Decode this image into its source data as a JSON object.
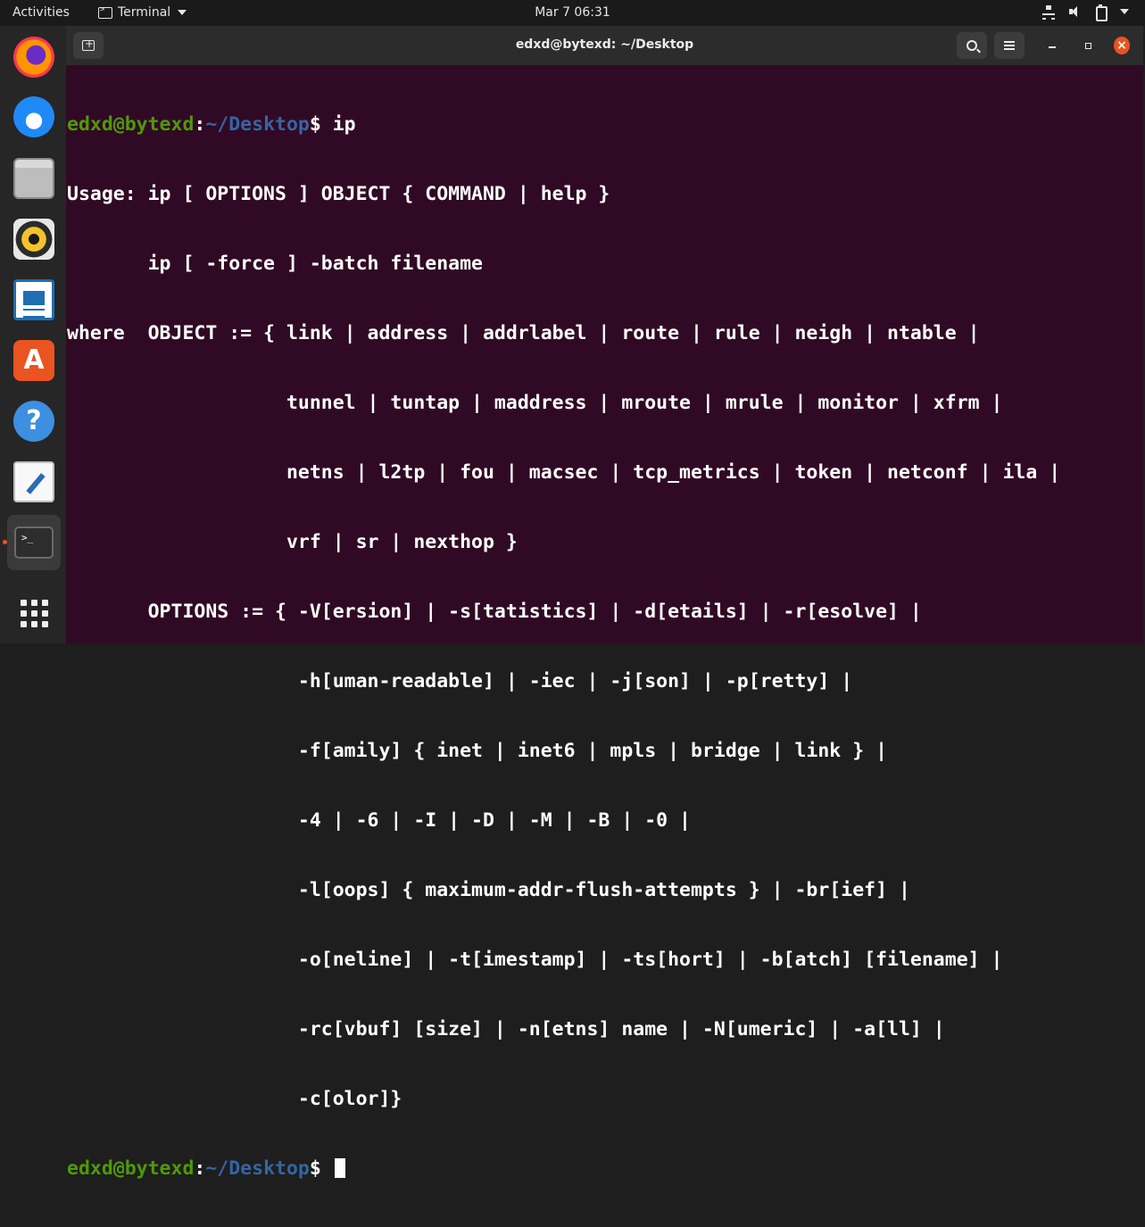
{
  "topbar": {
    "activities": "Activities",
    "app_name": "Terminal",
    "clock": "Mar 7  06:31",
    "icons": [
      "network-icon",
      "volume-icon",
      "battery-icon",
      "system-menu-caret"
    ]
  },
  "dock": {
    "apps": [
      {
        "name": "firefox",
        "icon": "firefox-icon"
      },
      {
        "name": "thunderbird",
        "icon": "thunderbird-icon"
      },
      {
        "name": "files",
        "icon": "files-icon"
      },
      {
        "name": "rhythmbox",
        "icon": "rhythmbox-icon"
      },
      {
        "name": "libreoffice-writer",
        "icon": "writer-icon"
      },
      {
        "name": "ubuntu-software",
        "icon": "software-icon"
      },
      {
        "name": "help",
        "icon": "help-icon"
      },
      {
        "name": "text-editor",
        "icon": "text-editor-icon"
      },
      {
        "name": "terminal",
        "icon": "terminal-icon",
        "active": true
      },
      {
        "name": "show-applications",
        "icon": "app-grid-icon"
      }
    ],
    "software_glyph": "A",
    "help_glyph": "?",
    "terminal_glyph": ">_"
  },
  "window": {
    "title": "edxd@bytexd: ~/Desktop",
    "close_glyph": "×"
  },
  "terminal": {
    "prompt_user": "edxd@bytexd",
    "prompt_sep": ":",
    "prompt_path": "~/Desktop",
    "prompt_end": "$ ",
    "command": "ip",
    "output": [
      "Usage: ip [ OPTIONS ] OBJECT { COMMAND | help }",
      "       ip [ -force ] -batch filename",
      "where  OBJECT := { link | address | addrlabel | route | rule | neigh | ntable |",
      "                   tunnel | tuntap | maddress | mroute | mrule | monitor | xfrm |",
      "                   netns | l2tp | fou | macsec | tcp_metrics | token | netconf | ila |",
      "                   vrf | sr | nexthop }",
      "       OPTIONS := { -V[ersion] | -s[tatistics] | -d[etails] | -r[esolve] |",
      "                    -h[uman-readable] | -iec | -j[son] | -p[retty] |",
      "                    -f[amily] { inet | inet6 | mpls | bridge | link } |",
      "                    -4 | -6 | -I | -D | -M | -B | -0 |",
      "                    -l[oops] { maximum-addr-flush-attempts } | -br[ief] |",
      "                    -o[neline] | -t[imestamp] | -ts[hort] | -b[atch] [filename] |",
      "                    -rc[vbuf] [size] | -n[etns] name | -N[umeric] | -a[ll] |",
      "                    -c[olor]}"
    ]
  },
  "colors": {
    "terminal_bg": "#300a24",
    "prompt_user": "#4e9a06",
    "prompt_path": "#3465a4",
    "accent": "#e95420"
  }
}
